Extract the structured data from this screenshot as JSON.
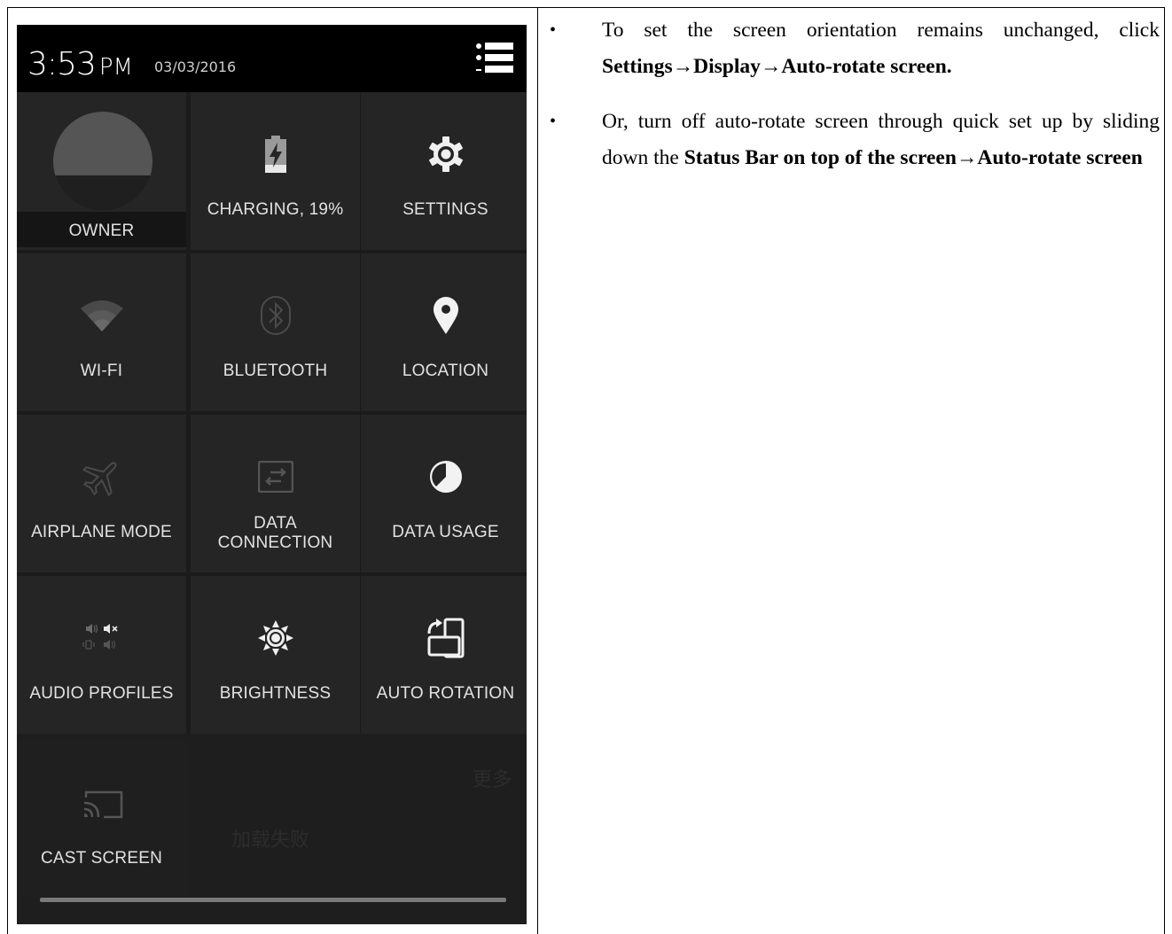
{
  "status_bar": {
    "time": "3:53",
    "ampm": "PM",
    "date": "03/03/2016"
  },
  "tiles": [
    {
      "label": "OWNER",
      "icon": "avatar-icon"
    },
    {
      "label": "CHARGING, 19%",
      "icon": "battery-charging-icon"
    },
    {
      "label": "SETTINGS",
      "icon": "gear-icon"
    },
    {
      "label": "WI-FI",
      "icon": "wifi-icon"
    },
    {
      "label": "BLUETOOTH",
      "icon": "bluetooth-icon"
    },
    {
      "label": "LOCATION",
      "icon": "location-pin-icon"
    },
    {
      "label": "AIRPLANE MODE",
      "icon": "airplane-icon"
    },
    {
      "label": "DATA",
      "label2": "CONNECTION",
      "icon": "data-connection-icon"
    },
    {
      "label": "DATA USAGE",
      "icon": "data-usage-icon"
    },
    {
      "label": "AUDIO PROFILES",
      "icon": "audio-profiles-icon"
    },
    {
      "label": "BRIGHTNESS",
      "icon": "brightness-icon"
    },
    {
      "label": "AUTO ROTATION",
      "icon": "auto-rotate-icon"
    },
    {
      "label": "CAST SCREEN",
      "icon": "cast-icon"
    }
  ],
  "ghost_text": {
    "more": "更多",
    "load_failed": "加载失败"
  },
  "notes": {
    "bullet": "•",
    "note1_text": "To set the screen orientation remains unchanged, click ",
    "note1_bold": "Settings→Display→Auto-rotate screen.",
    "note2_text": "Or, turn off auto-rotate screen through quick set up by sliding down the ",
    "note2_bold": "Status Bar on top of the screen→Auto-rotate screen"
  },
  "colors": {
    "tile_bg": "#252525",
    "status_bg": "#000000",
    "text_light": "#e2e2e2"
  }
}
